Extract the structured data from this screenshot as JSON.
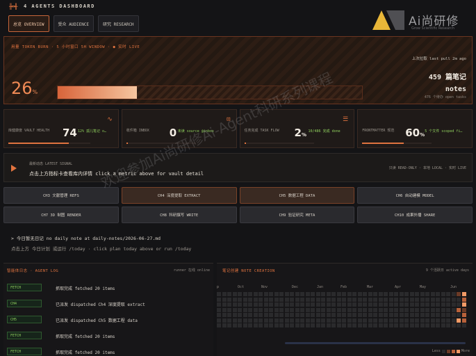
{
  "header": {
    "logo_glyph": "╫═╫",
    "title": "4 AGENTS DASHBOARD"
  },
  "tabs": [
    {
      "label": "总览 OVERVIEW",
      "active": true
    },
    {
      "label": "受众 AUDIENCE",
      "active": false
    },
    {
      "label": "研究 RESEARCH",
      "active": false
    }
  ],
  "brand": {
    "name": "Ai尚研修",
    "sub": "Grow Scientific Research"
  },
  "hero": {
    "label": "用量 TOKEN BURN · 5 小时窗口 5H WINDOW · ● 实时 LIVE",
    "percent": 26,
    "percent_text": "26",
    "percent_unit": "%",
    "last_pull": "上次拉取 last pull 2m ago",
    "notes_count": "459 篇笔记",
    "notes_label": "notes",
    "open_tasks": "476 个待办 open tasks"
  },
  "cards": [
    {
      "title": "库健康度 VAULT HEALTH",
      "value": "74",
      "sub": "12% 孤儿笔记 o…",
      "icon": "pulse-icon",
      "level": 0.74
    },
    {
      "title": "收件箱 INBOX",
      "value": "0",
      "sub": "未读 source @inbox",
      "icon": "inbox-icon",
      "level": 0.02
    },
    {
      "title": "任务完成 TASK FLOW",
      "value": "2",
      "value_unit": "%",
      "sub": "10/486 完成 done",
      "icon": "checklist-icon",
      "level": 0.02
    },
    {
      "title": "FRONTMATTER 规范",
      "value": "60",
      "value_unit": "%",
      "sub": "5 个文件 scoped fi…",
      "icon": "",
      "level": 0.6
    }
  ],
  "signal": {
    "tag": "最新动态 LATEST SIGNAL",
    "message": "点击上方指标卡查看库内详情 click a metric above for vault detail",
    "right": "只读 READ-ONLY · 本地 LOCAL · 实时 LIVE"
  },
  "chapters": [
    {
      "label": "CH3 文献管理 REFS",
      "highlight": false
    },
    {
      "label": "CH4 深度提取 EXTRACT",
      "highlight": true
    },
    {
      "label": "CH5 数据工程 DATA",
      "highlight": true
    },
    {
      "label": "CH6 自动建模 MODEL",
      "highlight": false
    },
    {
      "label": "CH7 3D 制图 RENDER",
      "highlight": false
    },
    {
      "label": "CH8 科研撰写 WRITE",
      "highlight": false
    },
    {
      "label": "CH9 验证研究 META",
      "highlight": false
    },
    {
      "label": "CH10 成果外播 SHARE",
      "highlight": false
    }
  ],
  "daily": {
    "line1": "> 今日暂无日记 no daily note at daily-notes/2026-06-27.md",
    "line2": "点击上方 今日计划 或运行 /today · click plan today above or run /today"
  },
  "agent_log": {
    "title": "智能体日志 · AGENT LOG",
    "runner": "runner 在线 online",
    "rows": [
      {
        "tag": "FETCH",
        "text": "抓取完成 fetched 20 items"
      },
      {
        "tag": "CH4",
        "text": "已派发 dispatched Ch4 深度提取 extract"
      },
      {
        "tag": "CH5",
        "text": "已派发 dispatched Ch5 数据工程 data"
      },
      {
        "tag": "FETCH",
        "text": "抓取完成 fetched 20 items"
      },
      {
        "tag": "FETCH",
        "text": "抓取完成 fetched 20 items"
      }
    ]
  },
  "note_creation": {
    "title": "笔记创建 NOTE CREATION",
    "active_days": "9 个活跃日 active days",
    "months": [
      "p",
      "Oct",
      "Nov",
      "Dec",
      "Jan",
      "Feb",
      "Mar",
      "Apr",
      "May",
      "Jun"
    ],
    "legend_less": "Less",
    "legend_more": "More",
    "colors": {
      "empty": "#2a2a2c",
      "l1": "#6b3a26",
      "l2": "#b8613a",
      "l3": "#f29a66"
    }
  },
  "watermark": "欢迎参加Ai尚研修Ai-Agent科研系列课程"
}
